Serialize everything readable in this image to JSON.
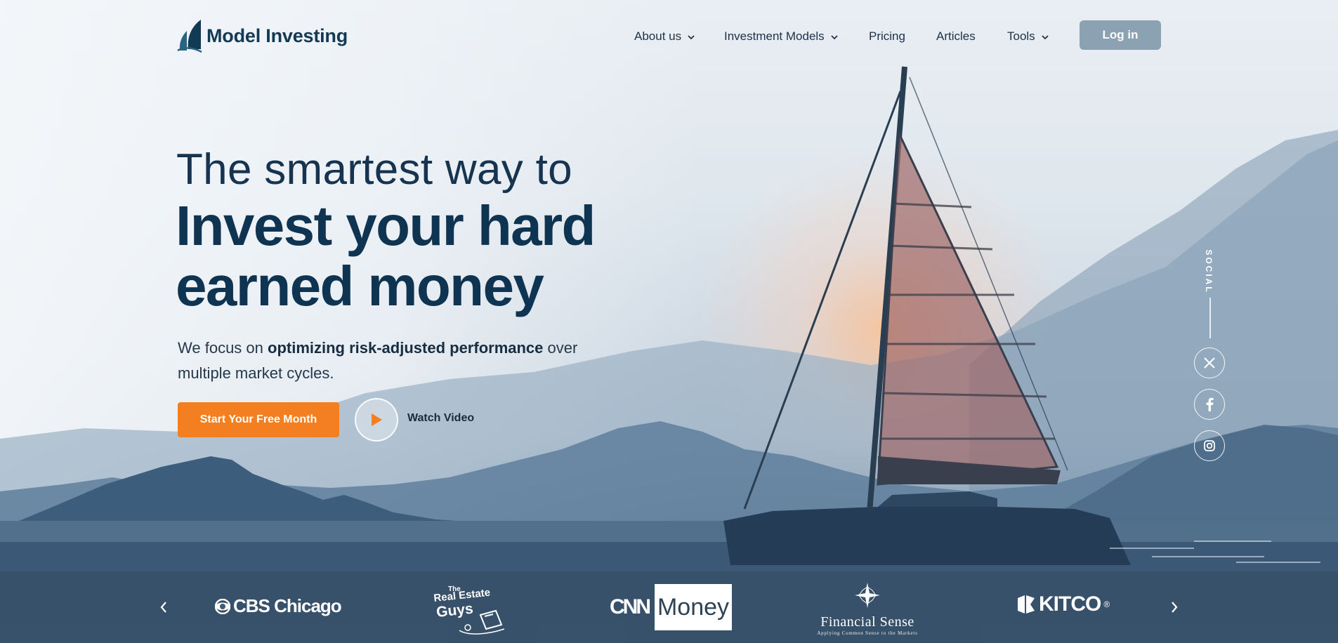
{
  "brand": {
    "name": "Model Investing"
  },
  "nav": {
    "items": [
      {
        "label": "About us",
        "has_dropdown": true
      },
      {
        "label": "Investment Models",
        "has_dropdown": true
      },
      {
        "label": "Pricing",
        "has_dropdown": false
      },
      {
        "label": "Articles",
        "has_dropdown": false
      },
      {
        "label": "Tools",
        "has_dropdown": true
      }
    ],
    "login_label": "Log in"
  },
  "hero": {
    "line1": "The smartest way to",
    "line2": "Invest your hard",
    "line3": "earned money",
    "sub_prefix": "We focus on ",
    "sub_bold": "optimizing risk-adjusted performance",
    "sub_suffix": " over multiple market cycles.",
    "cta_label": "Start Your Free Month",
    "video_label": "Watch Video"
  },
  "social": {
    "label": "SOCIAL",
    "icons": [
      "x-icon",
      "facebook-icon",
      "instagram-icon"
    ]
  },
  "press": {
    "cbs": "CBS Chicago",
    "reg_line1": "The",
    "reg_line2": "Real Estate",
    "reg_line3": "Guys",
    "cnn": "CNN",
    "money": "Money",
    "fs_name": "Financial Sense",
    "fs_tagline": "Applying Common Sense to the Markets",
    "kitco": "KITCO",
    "kitco_mark": "®"
  },
  "colors": {
    "accent": "#f47f21",
    "brand_navy": "#0e3451",
    "login_bg": "#8ba2b2",
    "press_strip": "#365067"
  }
}
